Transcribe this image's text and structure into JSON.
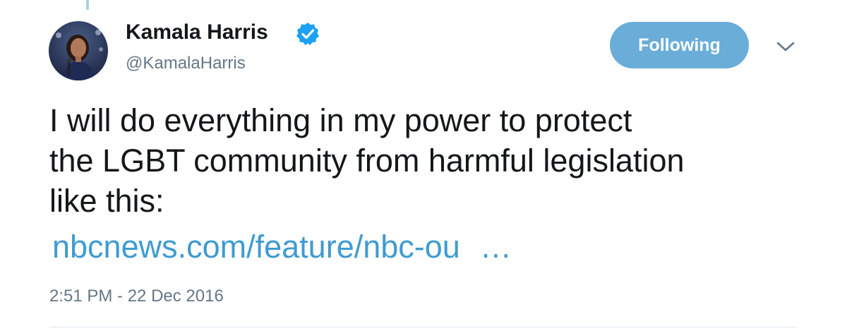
{
  "tweet": {
    "author": {
      "display_name": "Kamala Harris",
      "handle": "@KamalaHarris",
      "verified": true,
      "avatar_icon": "profile-photo"
    },
    "follow_button_label": "Following",
    "menu_icon": "chevron-down-icon",
    "text_lines": [
      "I will do everything in my power to protect",
      "the LGBT community from harmful legislation",
      "like this:"
    ],
    "link": {
      "text": "nbcnews.com/feature/nbc-ou",
      "ellipsis": "…"
    },
    "timestamp": "2:51 PM - 22 Dec 2016"
  },
  "colors": {
    "accent": "#3f9bd1",
    "follow_button_bg": "#6aadd8",
    "verified_badge": "#1da1f2",
    "secondary_text": "#657786",
    "primary_text": "#14171a",
    "divider": "#e1e8ed"
  }
}
